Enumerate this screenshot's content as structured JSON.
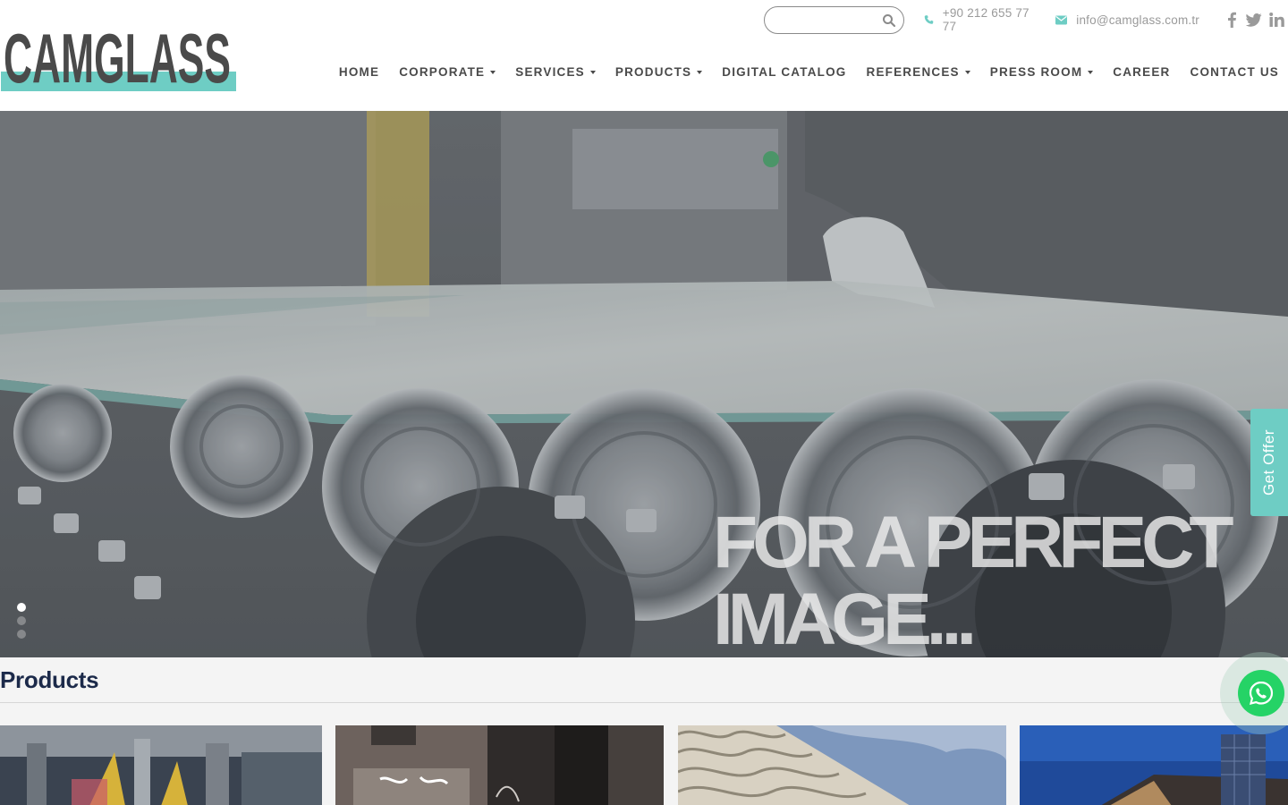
{
  "brand": {
    "logo_text": "CAMGLASS",
    "accent_color": "#6ecdc4",
    "logo_color": "#4a4a4a"
  },
  "topbar": {
    "search_placeholder": "",
    "phone": "+90 212 655 77 77",
    "email": "info@camglass.com.tr",
    "socials": [
      "facebook-icon",
      "twitter-icon",
      "linkedin-icon"
    ]
  },
  "nav": {
    "items": [
      {
        "label": "HOME",
        "dropdown": false
      },
      {
        "label": "CORPORATE",
        "dropdown": true
      },
      {
        "label": "SERVICES",
        "dropdown": true
      },
      {
        "label": "PRODUCTS",
        "dropdown": true
      },
      {
        "label": "DIGITAL CATALOG",
        "dropdown": false
      },
      {
        "label": "REFERENCES",
        "dropdown": true
      },
      {
        "label": "PRESS ROOM",
        "dropdown": true
      },
      {
        "label": "CAREER",
        "dropdown": false
      },
      {
        "label": "CONTACT US",
        "dropdown": false
      }
    ]
  },
  "hero": {
    "line1": "FOR A PERFECT",
    "line2": "IMAGE...",
    "slides_total": 3,
    "active_slide": 1
  },
  "get_offer": {
    "label": "Get Offer"
  },
  "products": {
    "title": "Products"
  }
}
